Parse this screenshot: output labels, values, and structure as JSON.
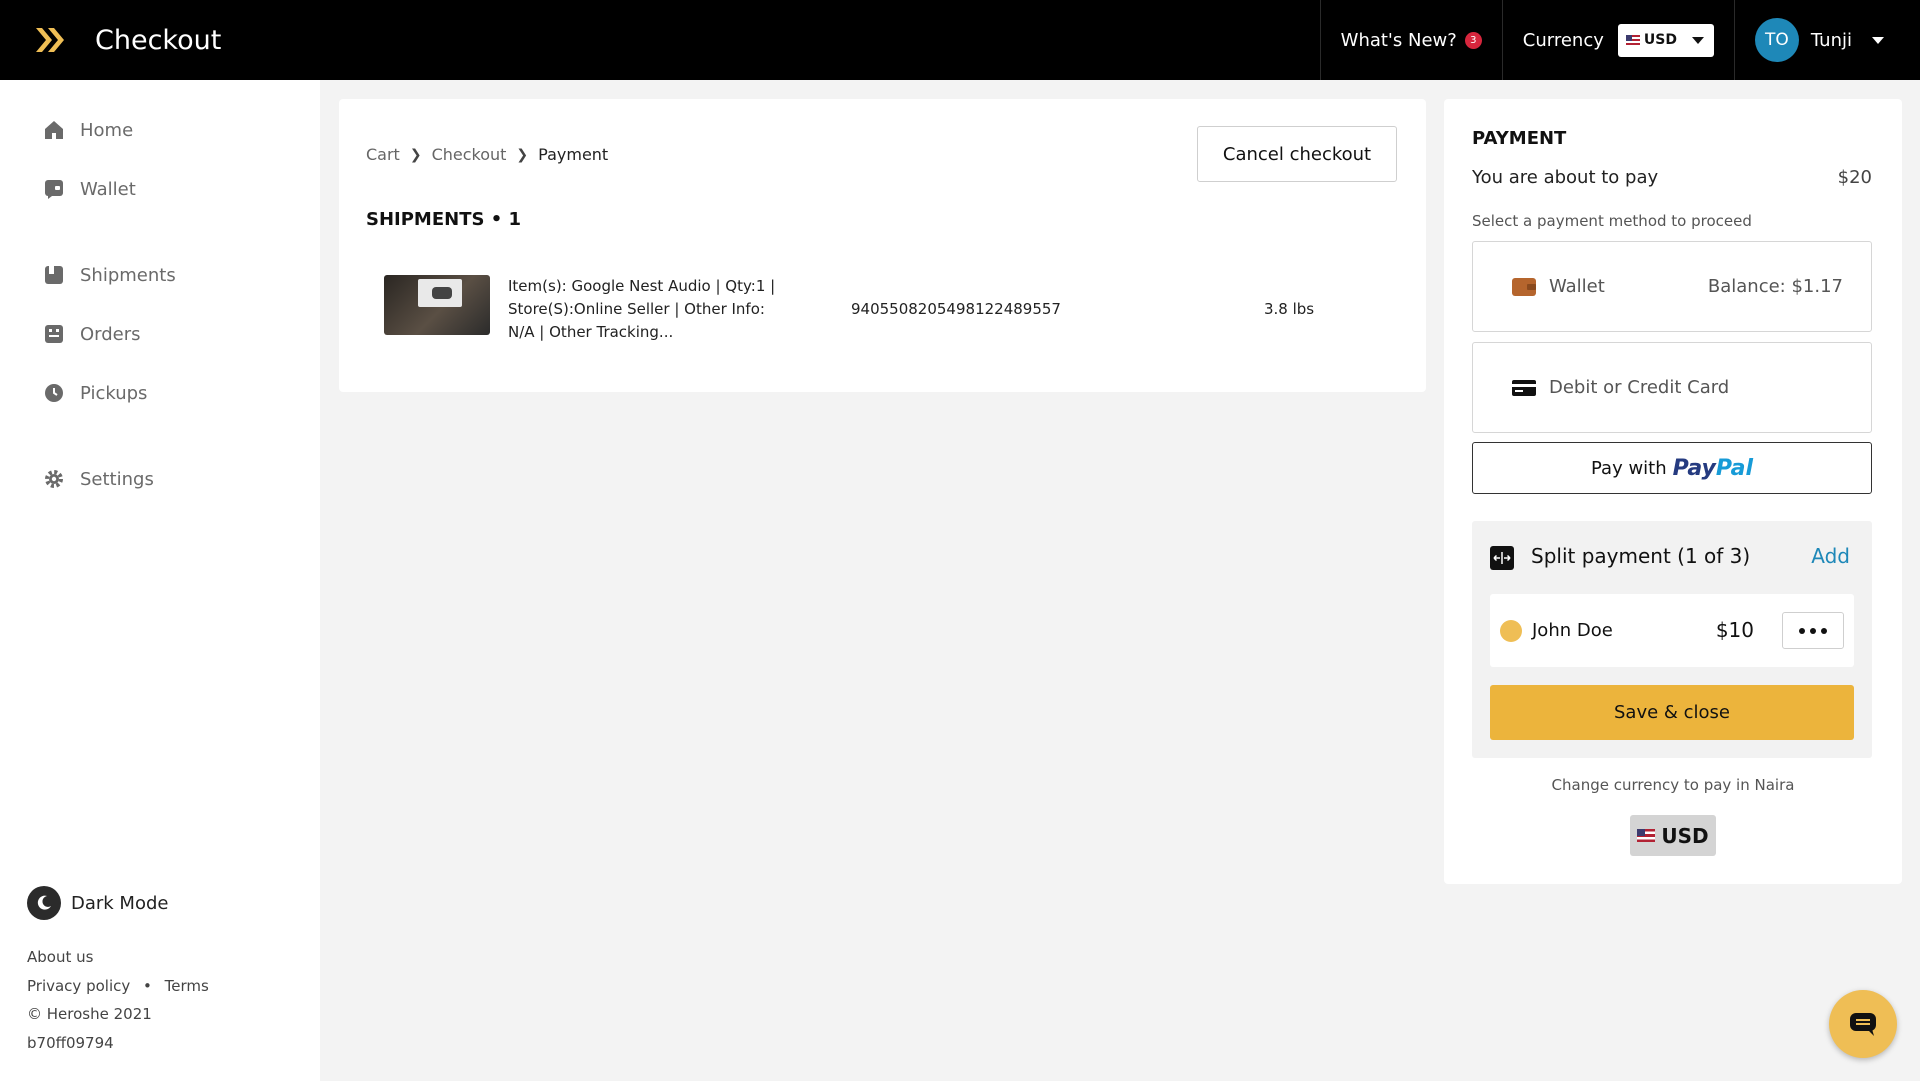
{
  "app": {
    "title": "Checkout"
  },
  "topbar": {
    "whats_new": "What's New?",
    "whats_new_count": "3",
    "currency_label": "Currency",
    "currency_value": "USD",
    "user_initials": "TO",
    "user_name": "Tunji"
  },
  "sidebar": {
    "items": [
      {
        "label": "Home",
        "icon": "home-icon"
      },
      {
        "label": "Wallet",
        "icon": "wallet-icon"
      },
      {
        "label": "Shipments",
        "icon": "shipments-icon"
      },
      {
        "label": "Orders",
        "icon": "orders-icon"
      },
      {
        "label": "Pickups",
        "icon": "pickups-icon"
      },
      {
        "label": "Settings",
        "icon": "gear-icon"
      }
    ],
    "dark_mode": "Dark Mode",
    "about": "About us",
    "privacy": "Privacy policy",
    "dot": "•",
    "terms": "Terms",
    "copyright": "© Heroshe 2021",
    "build": "b70ff09794"
  },
  "main": {
    "breadcrumb": [
      "Cart",
      "Checkout",
      "Payment"
    ],
    "cancel_label": "Cancel checkout",
    "shipments_title": "SHIPMENTS • 1",
    "shipment": {
      "description": "Item(s): Google Nest Audio | Qty:1 | Store(S):Online Seller | Other Info: N/A | Other Tracking...",
      "tracking": "9405508205498122489557",
      "weight": "3.8 lbs"
    }
  },
  "payment": {
    "title": "PAYMENT",
    "about_to_pay": "You are about to pay",
    "amount": "$20",
    "select_hint": "Select a payment method to proceed",
    "wallet_label": "Wallet",
    "wallet_balance": "Balance: $1.17",
    "card_label": "Debit or Credit Card",
    "paypal_prefix": "Pay with",
    "paypal_logo_a": "Pay",
    "paypal_logo_b": "Pal",
    "split_title": "Split payment (1 of 3)",
    "split_add": "Add",
    "split_name": "John Doe",
    "split_amount": "$10",
    "save_label": "Save & close",
    "change_currency": "Change currency to pay in Naira",
    "currency_chip": "USD"
  },
  "colors": {
    "accent": "#ecb43c",
    "link": "#1e88b8",
    "topbar": "#000000",
    "badge": "#d7263d"
  }
}
